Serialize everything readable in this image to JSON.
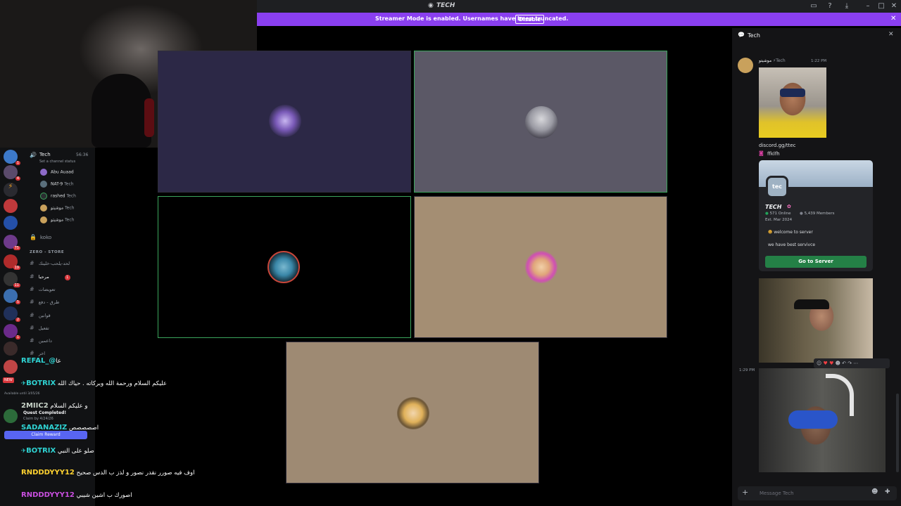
{
  "window": {
    "title": "TECH"
  },
  "banner": {
    "text": "Streamer Mode is enabled. Usernames have been truncated.",
    "button": "Disable"
  },
  "voice_panel": {
    "channel": "Tech",
    "timer": "56:36",
    "status_prompt": "Set a channel status",
    "users": [
      {
        "name": "Abu Auaad",
        "color": "#8d6ac8"
      },
      {
        "name": "NAT-9",
        "tag": "Tech",
        "color": "#5a6f7c"
      },
      {
        "name": "rashed",
        "tag": "Tech",
        "color": "#2b2d31"
      },
      {
        "name": "موشيتو",
        "tag": "Tech",
        "color": "#c9a15c"
      },
      {
        "name": "موشيتو",
        "tag": "Tech",
        "color": "#c9a15c"
      }
    ],
    "locked_channel": "koko",
    "category": "ZERO - STORE",
    "text_channels": [
      "لحد-يلحب-خلينك",
      "مرحبا",
      "تعويضات",
      "طرق - دفع",
      "قوانين",
      "تفعيل",
      "داعمين",
      "اخر"
    ]
  },
  "server_badges": [
    "1",
    "4",
    "6",
    "75",
    "19",
    "11",
    "5",
    "2",
    "1"
  ],
  "quest": {
    "available": "Available until 3/05/26",
    "title": "Quest Completed!",
    "claim_by": "Claim by 4/24/26",
    "button": "Claim Reward",
    "new_badge": "NEW"
  },
  "stream_chat": [
    {
      "nick": "REFAL_@",
      "message": "عا",
      "color": "#2fd4d4"
    },
    {
      "nick": "BOTRIX",
      "message": "عليكم السلام ورحمة الله وبركاته . حياك الله",
      "color": "#2fd4d4"
    },
    {
      "nick": "2MIIC2",
      "message": "و عليكم السلام",
      "color": "#c9d4c9"
    },
    {
      "nick": "SADANAZIZ",
      "message": "اصصصصص",
      "color": "#2fd4d4"
    },
    {
      "nick": "BOTRIX",
      "message": "صلو على النبي",
      "color": "#2fd4d4"
    },
    {
      "nick": "RNDDDYYY12",
      "message": "اوف فيه صورر نقدر نصور و لذز ب الدس صحيح",
      "color": "#ffd230"
    },
    {
      "nick": "RNDDDYYY12",
      "message": "اصورك ب اشين شيبي",
      "color": "#c94fe0"
    }
  ],
  "tiles": [
    {
      "name": "tile-1",
      "bg": "#2c2846",
      "active": false,
      "avatar_color": "#7a5ab8"
    },
    {
      "name": "tile-2",
      "bg": "#5b5866",
      "active": true,
      "avatar_color": "#9a9aa3"
    },
    {
      "name": "tile-3",
      "bg": "#000000",
      "active": true,
      "avatar_color": "#3a87a8"
    },
    {
      "name": "tile-4",
      "bg": "#a48e73",
      "active": false,
      "avatar_color": "#e0a67a"
    },
    {
      "name": "tile-5",
      "bg": "#9e8a73",
      "active": false,
      "avatar_color": "#e0b15a"
    }
  ],
  "right_panel": {
    "title": "Tech",
    "author": "موشيتو",
    "author_tag": "Tech",
    "time1": "1:22 PM",
    "link": "discord.gg/ttec",
    "ig": "ffklfh",
    "server_card": {
      "logo": "tec",
      "name": "TECH",
      "online": "571 Online",
      "members": "5,439 Members",
      "est": "Est. Mar 2024",
      "line1": "welcome to server",
      "line2": "we have best servivce",
      "button": "Go to Server"
    },
    "time2": "1:29 PM",
    "input_placeholder": "Message Tech"
  }
}
